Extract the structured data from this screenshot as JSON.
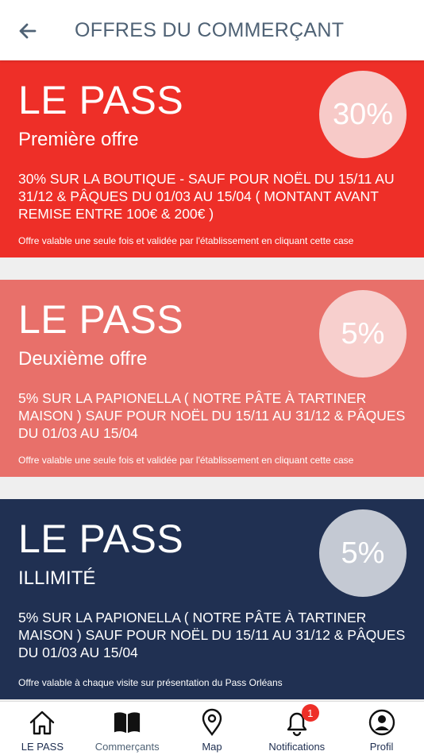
{
  "header": {
    "title": "OFFRES DU COMMERÇANT"
  },
  "offers": [
    {
      "pass": "LE PASS",
      "badge": "30%",
      "subtitle": "Première offre",
      "description": "30% SUR LA BOUTIQUE - SAUF POUR NOËL DU 15/11 AU 31/12 & PÂQUES DU 01/03 AU 15/04 ( MONTANT AVANT REMISE ENTRE 100€ & 200€ )",
      "note": "Offre valable une seule fois et validée par l'établissement en cliquant cette case",
      "color": "#ee2f28"
    },
    {
      "pass": "LE PASS",
      "badge": "5%",
      "subtitle": "Deuxième offre",
      "description": "5% SUR LA PAPIONELLA ( NOTRE PÂTE À TARTINER MAISON ) SAUF POUR NOËL DU 15/11 AU 31/12 & PÂQUES DU 01/03 AU 15/04",
      "note": "Offre valable une seule fois et validée par l'établissement en cliquant cette case",
      "color": "#e8706a"
    },
    {
      "pass": "LE PASS",
      "badge": "5%",
      "subtitle": "ILLIMITÉ",
      "description": "5% SUR LA PAPIONELLA ( NOTRE PÂTE À TARTINER MAISON ) SAUF POUR NOËL DU 15/11 AU 31/12 & PÂQUES DU 01/03 AU 15/04",
      "note": "Offre valable à chaque visite sur présentation du Pass Orléans",
      "color": "#203052"
    }
  ],
  "tabs": [
    {
      "label": "LE PASS",
      "icon": "home-icon"
    },
    {
      "label": "Commerçants",
      "icon": "book-icon",
      "active": true
    },
    {
      "label": "Map",
      "icon": "map-pin-icon"
    },
    {
      "label": "Notifications",
      "icon": "bell-icon",
      "badge": "1"
    },
    {
      "label": "Profil",
      "icon": "user-icon"
    }
  ],
  "colors": {
    "primary_navy": "#203052",
    "red": "#ee2f28",
    "salmon": "#e8706a",
    "header_text": "#4f6275"
  }
}
